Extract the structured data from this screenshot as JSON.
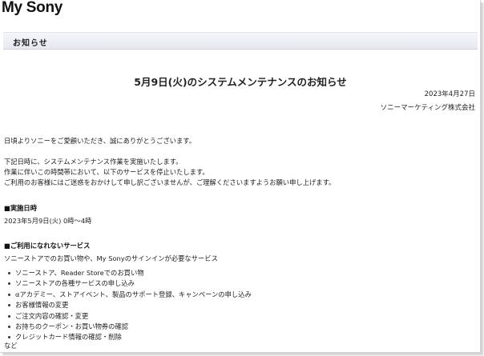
{
  "header": {
    "brand": "My Sony",
    "section_title": "お知らせ"
  },
  "notice": {
    "title": "5月9日(火)のシステムメンテナンスのお知らせ",
    "date": "2023年4月27日",
    "company": "ソニーマーケティング株式会社",
    "greeting": "日頃よりソニーをご愛顧いただき、誠にありがとうございます。",
    "intro_lines": [
      "下記日時に、システムメンテナンス作業を実施いたします。",
      "作業に伴いこの時間帯において、以下のサービスを停止いたします。",
      "ご利用のお客様にはご迷惑をおかけして申し訳ございませんが、ご理解くださいますようお願い申し上げます。"
    ],
    "schedule_heading": "■実施日時",
    "schedule_value": "2023年5月9日(火) 0時～4時",
    "services_heading": "■ご利用になれないサービス",
    "services_intro": "ソニーストアでのお買い物や、My Sonyのサインインが必要なサービス",
    "services": [
      "ソニーストア、Reader Storeでのお買い物",
      "ソニーストアの各種サービスの申し込み",
      "αアカデミー、ストアイベント、製品のサポート登録、キャンペーンの申し込み",
      "お客様情報の変更",
      "ご注文内容の確認・変更",
      "お持ちのクーポン・お買い物券の確認",
      "クレジットカード情報の確認・削除"
    ],
    "services_tail": "など"
  }
}
